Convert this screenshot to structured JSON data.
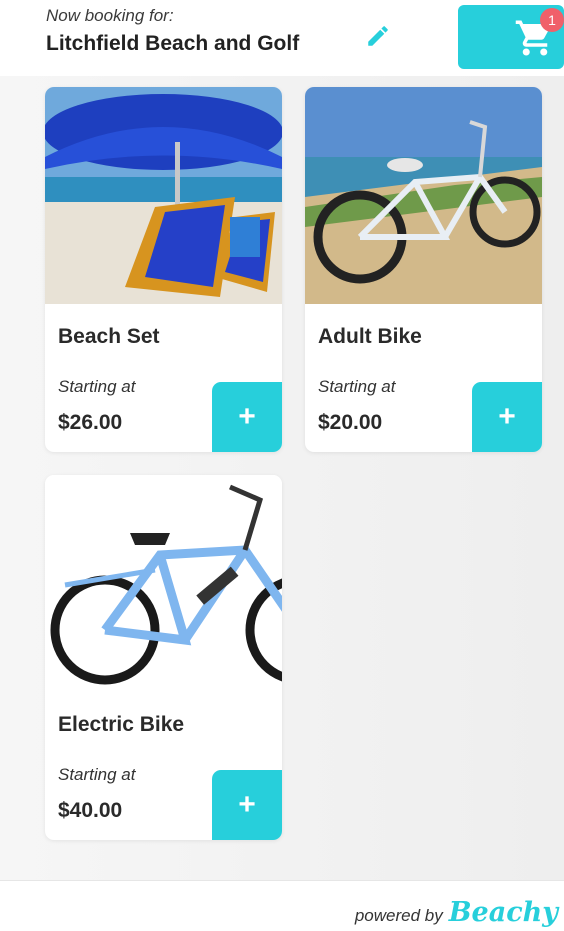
{
  "header": {
    "caption": "Now booking for:",
    "venue": "Litchfield Beach and Golf",
    "edit_icon": "pencil-icon",
    "cart_icon": "shopping-cart-icon",
    "cart_count": "1"
  },
  "products": [
    {
      "title": "Beach Set",
      "caption": "Starting at",
      "price": "$26.00",
      "add_label": "+",
      "image": "beach-umbrella-chairs"
    },
    {
      "title": "Adult Bike",
      "caption": "Starting at",
      "price": "$20.00",
      "add_label": "+",
      "image": "white-cruiser-bike"
    },
    {
      "title": "Electric Bike",
      "caption": "Starting at",
      "price": "$40.00",
      "add_label": "+",
      "image": "blue-electric-bike"
    }
  ],
  "footer": {
    "powered_label": "powered by",
    "brand": "Beachy"
  },
  "colors": {
    "accent": "#27cfdb",
    "badge": "#f0606a",
    "text": "#2a2a2a"
  }
}
